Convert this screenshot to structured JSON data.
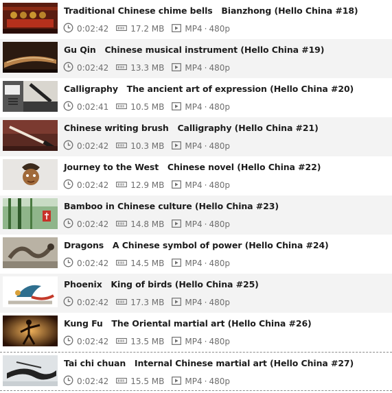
{
  "videos": [
    {
      "title": "Traditional Chinese chime bells   Bianzhong (Hello China #18)",
      "duration": "0:02:42",
      "size": "17.2 MB",
      "format": "MP4",
      "resolution": "480p",
      "thumb": "bells"
    },
    {
      "title": "Gu Qin   Chinese musical instrument (Hello China #19)",
      "duration": "0:02:42",
      "size": "13.3 MB",
      "format": "MP4",
      "resolution": "480p",
      "thumb": "guqin"
    },
    {
      "title": "Calligraphy   The ancient art of expression (Hello China #20)",
      "duration": "0:02:41",
      "size": "10.5 MB",
      "format": "MP4",
      "resolution": "480p",
      "thumb": "calligraphy"
    },
    {
      "title": "Chinese writing brush   Calligraphy (Hello China #21)",
      "duration": "0:02:42",
      "size": "10.3 MB",
      "format": "MP4",
      "resolution": "480p",
      "thumb": "brush"
    },
    {
      "title": "Journey to the West   Chinese novel (Hello China #22)",
      "duration": "0:02:42",
      "size": "12.9 MB",
      "format": "MP4",
      "resolution": "480p",
      "thumb": "journey"
    },
    {
      "title": "Bamboo in Chinese culture (Hello China #23)",
      "duration": "0:02:42",
      "size": "14.8 MB",
      "format": "MP4",
      "resolution": "480p",
      "thumb": "bamboo"
    },
    {
      "title": "Dragons   A Chinese symbol of power (Hello China #24)",
      "duration": "0:02:42",
      "size": "14.5 MB",
      "format": "MP4",
      "resolution": "480p",
      "thumb": "dragon"
    },
    {
      "title": "Phoenix   King of birds (Hello China #25)",
      "duration": "0:02:42",
      "size": "17.3 MB",
      "format": "MP4",
      "resolution": "480p",
      "thumb": "phoenix"
    },
    {
      "title": "Kung Fu   The Oriental martial art (Hello China #26)",
      "duration": "0:02:42",
      "size": "13.5 MB",
      "format": "MP4",
      "resolution": "480p",
      "thumb": "kungfu"
    },
    {
      "title": "Tai chi chuan   Internal Chinese martial art (Hello China #27)",
      "duration": "0:02:42",
      "size": "15.5 MB",
      "format": "MP4",
      "resolution": "480p",
      "thumb": "taichi"
    }
  ],
  "colors": {
    "title": "#1c1c1c",
    "meta": "#6e6e6e",
    "alt_row": "#f3f3f3"
  },
  "icons": {
    "duration": "clock-icon",
    "size": "file-size-icon",
    "format": "video-play-icon"
  }
}
